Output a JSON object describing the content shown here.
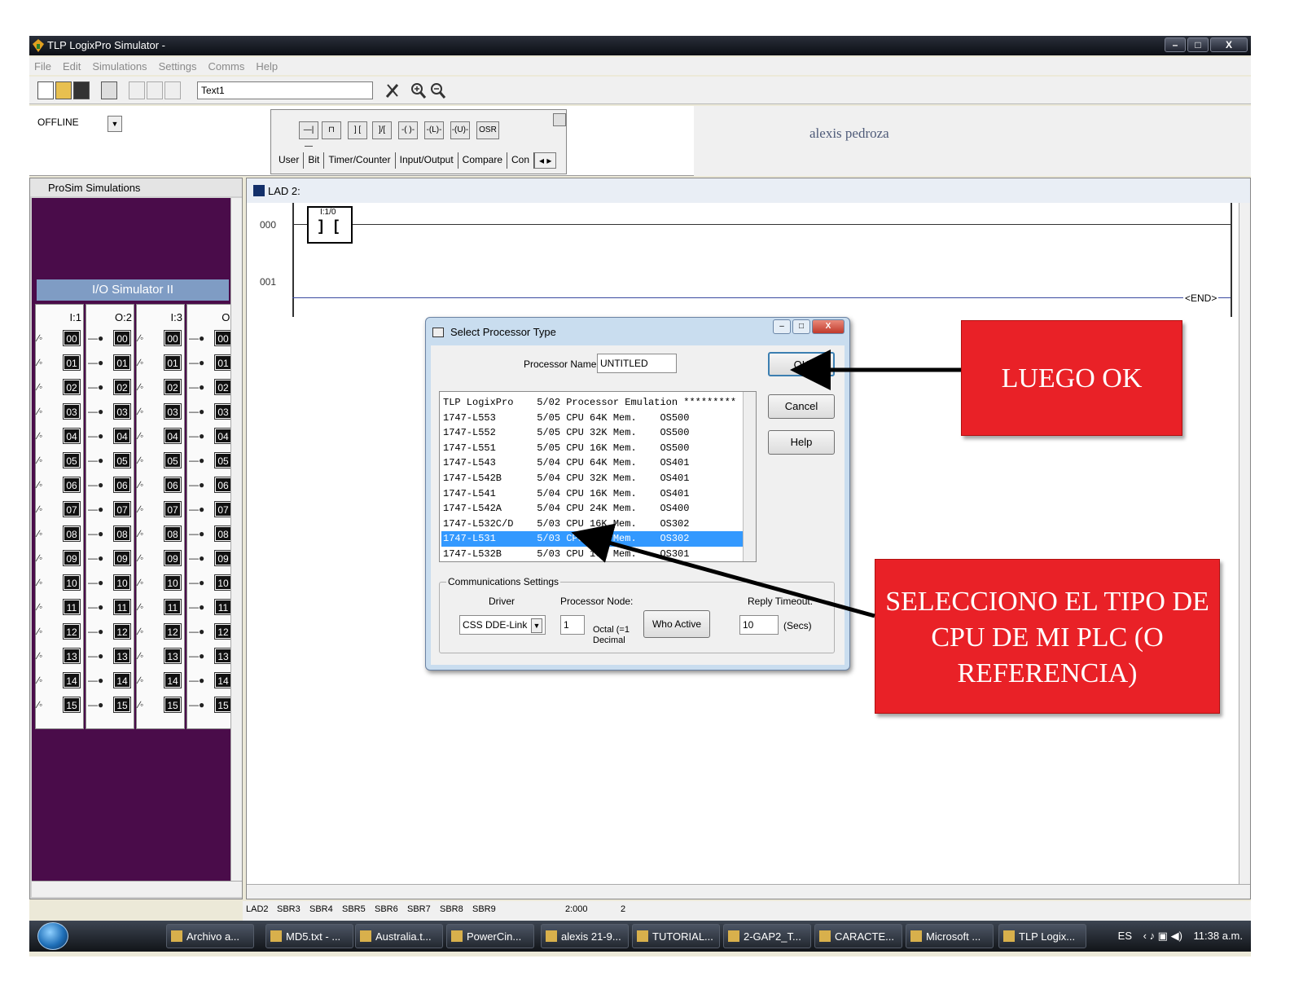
{
  "window": {
    "title": "TLP LogixPro Simulator -",
    "buttons": [
      "–",
      "□",
      "X"
    ]
  },
  "menu": [
    "File",
    "Edit",
    "Simulations",
    "Settings",
    "Comms",
    "Help"
  ],
  "toolbar": {
    "text_value": "Text1"
  },
  "mode": {
    "value": "OFFLINE"
  },
  "instructions": {
    "icons": [
      "—|—",
      "⊓",
      "] [",
      "]/[",
      "-( )-",
      "-(L)-",
      "-(U)-",
      "OSR"
    ],
    "tabs": [
      "User",
      "Bit",
      "Timer/Counter",
      "Input/Output",
      "Compare",
      "Con"
    ]
  },
  "user_name": "alexis pedroza",
  "prosim": {
    "title": "ProSim Simulations",
    "io_title": "I/O Simulator II",
    "columns": [
      "I:1",
      "O:2",
      "I:3",
      "O:"
    ],
    "rows": [
      "00",
      "01",
      "02",
      "03",
      "04",
      "05",
      "06",
      "07",
      "08",
      "09",
      "10",
      "11",
      "12",
      "13",
      "14",
      "15"
    ]
  },
  "ladder": {
    "title": "LAD 2:",
    "rungs": [
      "000",
      "001"
    ],
    "contact_addr": "I:1/0",
    "end_label": "END"
  },
  "status": {
    "tabs": [
      "LAD2",
      "SBR3",
      "SBR4",
      "SBR5",
      "SBR6",
      "SBR7",
      "SBR8",
      "SBR9"
    ],
    "address": "2:000",
    "count": "2"
  },
  "taskbar": {
    "items": [
      "Archivo a...",
      "MD5.txt - ...",
      "Australia.t...",
      "PowerCin...",
      "alexis 21-9...",
      "TUTORIAL...",
      "2-GAP2_T...",
      "CARACTE...",
      "Microsoft ...",
      "TLP Logix..."
    ],
    "lang": "ES",
    "clock": "11:38 a.m."
  },
  "dialog": {
    "title": "Select Processor Type",
    "processor_name_label": "Processor Name:",
    "processor_name_value": "UNTITLED",
    "ok": "OK",
    "cancel": "Cancel",
    "help": "Help",
    "processors": [
      "TLP LogixPro    5/02 Processor Emulation *********",
      "1747-L553       5/05 CPU 64K Mem.    OS500",
      "1747-L552       5/05 CPU 32K Mem.    OS500",
      "1747-L551       5/05 CPU 16K Mem.    OS500",
      "1747-L543       5/04 CPU 64K Mem.    OS401",
      "1747-L542B      5/04 CPU 32K Mem.    OS401",
      "1747-L541       5/04 CPU 16K Mem.    OS401",
      "1747-L542A      5/04 CPU 24K Mem.    OS400",
      "1747-L532C/D    5/03 CPU 16K Mem.    OS302",
      "1747-L531       5/03 CPU  8K Mem.    OS302",
      "1747-L532B      5/03 CPU 16K Mem.    OS301"
    ],
    "selected_index": 9,
    "comm": {
      "title": "Communications Settings",
      "driver_label": "Driver",
      "driver_value": "CSS DDE-Link",
      "node_label": "Processor Node:",
      "node_value": "1",
      "node_hint": "Octal (=1 Decimal",
      "who_active": "Who Active",
      "timeout_label": "Reply Timeout:",
      "timeout_value": "10",
      "timeout_unit": "(Secs)"
    }
  },
  "annotations": {
    "ok_note": "LUEGO OK",
    "cpu_note": "SELECCIONO EL TIPO DE CPU DE MI PLC (O REFERENCIA)",
    "color": "#e92127"
  }
}
